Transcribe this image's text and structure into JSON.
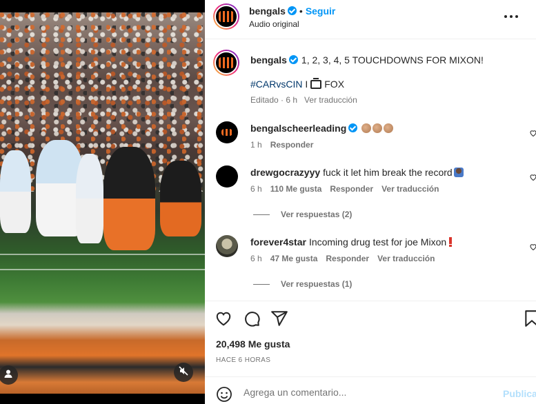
{
  "post": {
    "author": "bengals",
    "follow_label": "Seguir",
    "audio_label": "Audio original",
    "caption": "1, 2, 3, 4, 5 TOUCHDOWNS FOR MIXON!",
    "hashtag": "#CARvsCIN",
    "hashtag_sep": "I",
    "network": "FOX",
    "edited": "Editado · 6 h",
    "translate": "Ver traducción"
  },
  "comments": [
    {
      "user": "bengalscheerleading",
      "verified": true,
      "text": "",
      "emoji": "clap-clap-clap",
      "time": "1 h",
      "likes": "",
      "reply": "Responder",
      "translate": "",
      "replies": ""
    },
    {
      "user": "drewgocrazyyy",
      "verified": false,
      "text": "fuck it let him break the record",
      "emoji": "person-shrugging",
      "time": "6 h",
      "likes": "110 Me gusta",
      "reply": "Responder",
      "translate": "Ver traducción",
      "replies": "Ver respuestas (2)"
    },
    {
      "user": "forever4star",
      "verified": false,
      "text": "Incoming drug test for joe Mixon",
      "emoji": "exclamation",
      "time": "6 h",
      "likes": "47 Me gusta",
      "reply": "Responder",
      "translate": "Ver traducción",
      "replies": "Ver respuestas (1)"
    }
  ],
  "actions": {
    "likes": "20,498 Me gusta",
    "time_ago": "HACE 6 HORAS"
  },
  "add_comment": {
    "placeholder": "Agrega un comentario...",
    "publish": "Publicar"
  },
  "icons": [
    "verified-icon",
    "more-options-icon",
    "heart-icon",
    "comment-icon",
    "share-icon",
    "bookmark-icon",
    "emoji-icon",
    "user-tag-icon",
    "mute-icon",
    "tv-icon"
  ],
  "colors": {
    "link": "#00376b",
    "accent": "#0095f6",
    "publish_disabled": "#b2dffc",
    "meta": "#737373"
  }
}
